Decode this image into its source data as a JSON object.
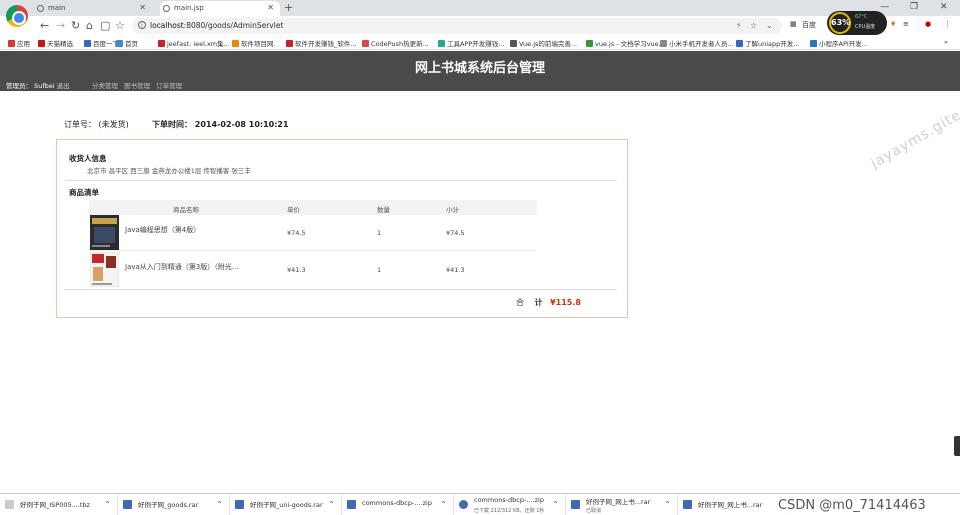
{
  "browser": {
    "tabs": [
      {
        "title": "main",
        "active": false
      },
      {
        "title": "main.jsp",
        "active": true
      }
    ],
    "new_tab": "+",
    "window_controls": {
      "minimize": "—",
      "maximize": "❐",
      "close": "✕"
    },
    "url": {
      "host": "localhost",
      "path": ":8080/goods/AdminServlet"
    },
    "translate_label": "百度",
    "gauge": {
      "value": "63%",
      "temp": "67°C",
      "cpu": "CPU温度"
    }
  },
  "bookmarks": [
    "应用",
    "天猫精选",
    "百度一下",
    "首页",
    "jeefast: ieel.xm集...",
    "软件项目网.",
    "软件开发赚钱_软件...",
    "CodePush热更新...",
    "工具APP开发赚钱...",
    "Vue.js的前端完善...",
    "vue.js - 文档学习vue...",
    "小米手机开发者人员...",
    "了解uniapp开发...",
    "小程序API开发..."
  ],
  "header": {
    "title": "网上书城系统后台管理",
    "admin_label": "管理员：",
    "admin_name": "Sufbei",
    "logout": "退出",
    "nav": [
      "分类管理",
      "图书管理",
      "订单管理"
    ]
  },
  "order": {
    "order_no_label": "订单号：",
    "order_no": "(未发货)",
    "time_label": "下单时间：",
    "time": "2014-02-08 10:10:21",
    "receiver_title": "收货人信息",
    "address": "北京市 昌平区 西三旗 金燕龙办公楼1层 传智播客 张三丰",
    "goods_title": "商品清单",
    "columns": [
      "商品名称",
      "单价",
      "数量",
      "小计"
    ],
    "items": [
      {
        "name": "Java编程思想（第4版）",
        "price": "¥74.5",
        "qty": "1",
        "subtotal": "¥74.5"
      },
      {
        "name": "Java从入门到精通（第3版）（附光...",
        "price": "¥41.3",
        "qty": "1",
        "subtotal": "¥41.3"
      }
    ],
    "total_prefix": "合",
    "total_label": "计",
    "total": "¥115.8"
  },
  "watermark": "jayayms.gitee",
  "downloads": [
    {
      "file": "好例子网_ISP005....tbz",
      "status": ""
    },
    {
      "file": "好例子网_goods.rar",
      "status": ""
    },
    {
      "file": "好例子网_uni-goods.rar",
      "status": ""
    },
    {
      "file": "commons-dbcp-....zip",
      "status": ""
    },
    {
      "file": "commons-dbcp-....zip",
      "status": "已下载 212/312 KB，还剩 1秒"
    },
    {
      "file": "好例子网_网上书...rar",
      "status": "已取消"
    },
    {
      "file": "好例子网_网上书...rar",
      "status": ""
    }
  ],
  "csdn_credit": "CSDN @m0_71414463",
  "colors": {
    "header_bg": "#4a4a4a",
    "box_border": "#e7c7a8",
    "total": "#cc3300"
  }
}
